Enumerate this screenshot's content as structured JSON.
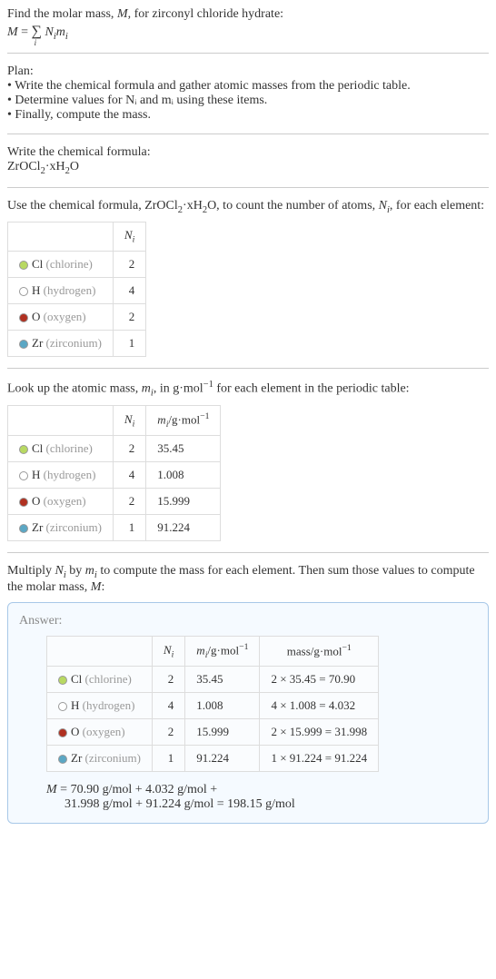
{
  "intro": {
    "line1": "Find the molar mass, ",
    "mvar": "M",
    "line1b": ", for zirconyl chloride hydrate:",
    "formula_lhs": "M",
    "formula_eq": " = ",
    "formula_sum": "∑",
    "formula_sub": "i",
    "formula_rhs1": " N",
    "formula_rhs1sub": "i",
    "formula_rhs2": "m",
    "formula_rhs2sub": "i"
  },
  "plan": {
    "heading": "Plan:",
    "items": [
      "• Write the chemical formula and gather atomic masses from the periodic table.",
      "• Determine values for Nᵢ and mᵢ using these items.",
      "• Finally, compute the mass."
    ]
  },
  "writeFormula": {
    "heading": "Write the chemical formula:",
    "formula_a": "ZrOCl",
    "formula_sub1": "2",
    "formula_mid": "·xH",
    "formula_sub2": "2",
    "formula_end": "O"
  },
  "countAtoms": {
    "text_a": "Use the chemical formula, ZrOCl",
    "text_sub1": "2",
    "text_b": "·xH",
    "text_sub2": "2",
    "text_c": "O, to count the number of atoms, ",
    "nvar": "N",
    "nvarsub": "i",
    "text_d": ", for each element:",
    "header_n": "N",
    "header_nsub": "i",
    "rows": [
      {
        "color": "#b8d962",
        "sym": "Cl",
        "name": "(chlorine)",
        "n": "2"
      },
      {
        "color": "#ffffff",
        "sym": "H",
        "name": "(hydrogen)",
        "n": "4"
      },
      {
        "color": "#b03020",
        "sym": "O",
        "name": "(oxygen)",
        "n": "2"
      },
      {
        "color": "#5ba7c4",
        "sym": "Zr",
        "name": "(zirconium)",
        "n": "1"
      }
    ]
  },
  "atomicMass": {
    "text_a": "Look up the atomic mass, ",
    "mvar": "m",
    "mvarsub": "i",
    "text_b": ", in g·mol",
    "text_sup": "−1",
    "text_c": " for each element in the periodic table:",
    "header_n": "N",
    "header_nsub": "i",
    "header_m": "m",
    "header_msub": "i",
    "header_m2": "/g·mol",
    "header_msup": "−1",
    "rows": [
      {
        "color": "#b8d962",
        "sym": "Cl",
        "name": "(chlorine)",
        "n": "2",
        "m": "35.45"
      },
      {
        "color": "#ffffff",
        "sym": "H",
        "name": "(hydrogen)",
        "n": "4",
        "m": "1.008"
      },
      {
        "color": "#b03020",
        "sym": "O",
        "name": "(oxygen)",
        "n": "2",
        "m": "15.999"
      },
      {
        "color": "#5ba7c4",
        "sym": "Zr",
        "name": "(zirconium)",
        "n": "1",
        "m": "91.224"
      }
    ]
  },
  "multiply": {
    "text_a": "Multiply ",
    "nvar": "N",
    "nsub": "i",
    "text_b": " by ",
    "mvar": "m",
    "msub": "i",
    "text_c": " to compute the mass for each element. Then sum those values to compute the molar mass, ",
    "Mvar": "M",
    "text_d": ":"
  },
  "answer": {
    "label": "Answer:",
    "header_n": "N",
    "header_nsub": "i",
    "header_m": "m",
    "header_msub": "i",
    "header_m2": "/g·mol",
    "header_msup": "−1",
    "header_mass": "mass/g·mol",
    "header_mass_sup": "−1",
    "rows": [
      {
        "color": "#b8d962",
        "sym": "Cl",
        "name": "(chlorine)",
        "n": "2",
        "m": "35.45",
        "mass": "2 × 35.45 = 70.90"
      },
      {
        "color": "#ffffff",
        "sym": "H",
        "name": "(hydrogen)",
        "n": "4",
        "m": "1.008",
        "mass": "4 × 1.008 = 4.032"
      },
      {
        "color": "#b03020",
        "sym": "O",
        "name": "(oxygen)",
        "n": "2",
        "m": "15.999",
        "mass": "2 × 15.999 = 31.998"
      },
      {
        "color": "#5ba7c4",
        "sym": "Zr",
        "name": "(zirconium)",
        "n": "1",
        "m": "91.224",
        "mass": "1 × 91.224 = 91.224"
      }
    ],
    "final_line1_a": "M",
    "final_line1_b": " = 70.90 g/mol + 4.032 g/mol + ",
    "final_line2": "31.998 g/mol + 91.224 g/mol = 198.15 g/mol"
  }
}
